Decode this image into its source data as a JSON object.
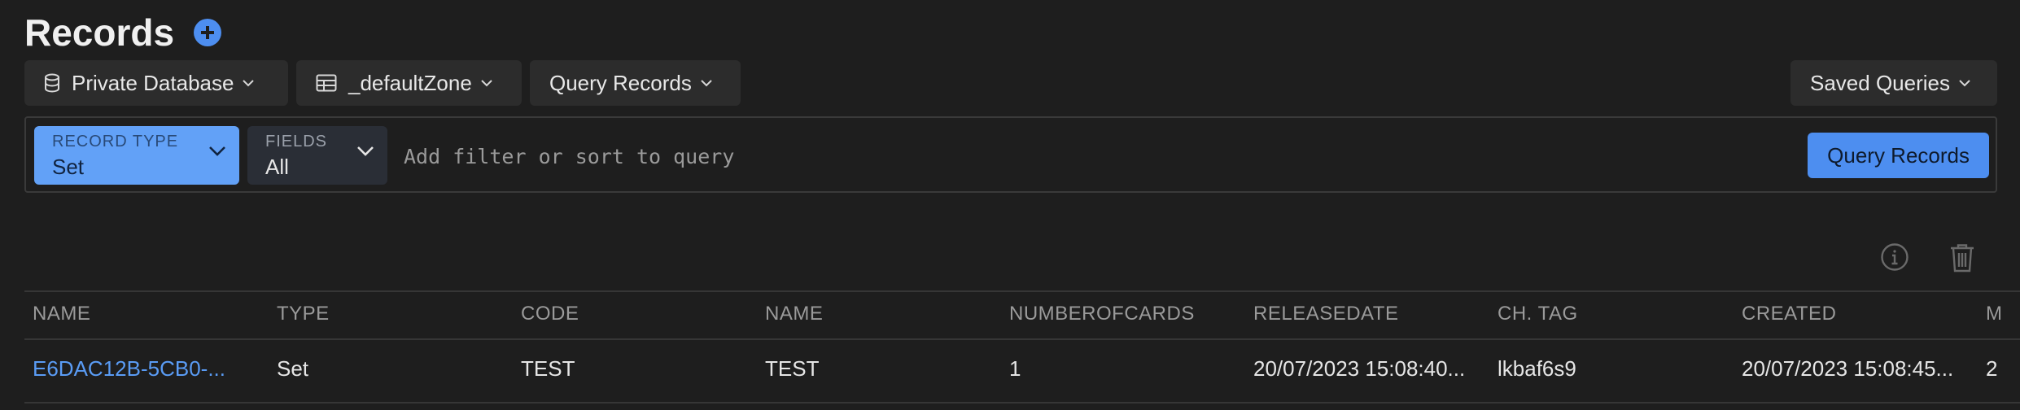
{
  "page": {
    "title": "Records"
  },
  "toolbar": {
    "database": "Private Database",
    "zone": "_defaultZone",
    "query_mode": "Query Records",
    "saved_queries": "Saved Queries"
  },
  "query": {
    "record_type_label": "RECORD TYPE",
    "record_type_value": "Set",
    "fields_label": "FIELDS",
    "fields_value": "All",
    "filter_placeholder": "Add filter or sort to query",
    "run_label": "Query Records"
  },
  "icons": {
    "add": "plus-circle-icon",
    "database": "database-icon",
    "zone": "table-icon",
    "info": "info-icon",
    "delete": "trash-icon"
  },
  "table": {
    "columns": [
      "NAME",
      "TYPE",
      "CODE",
      "NAME",
      "NUMBEROFCARDS",
      "RELEASEDATE",
      "CH. TAG",
      "CREATED",
      "M"
    ],
    "rows": [
      {
        "cells": [
          "E6DAC12B-5CB0-...",
          "Set",
          "TEST",
          "TEST",
          "1",
          "20/07/2023 15:08:40...",
          "lkbaf6s9",
          "20/07/2023 15:08:45...",
          "2"
        ]
      }
    ]
  },
  "colors": {
    "accent": "#4d8ef0",
    "background": "#1e1e1e",
    "link": "#5a9cf5",
    "record_type_chip": "#62a1f7"
  }
}
